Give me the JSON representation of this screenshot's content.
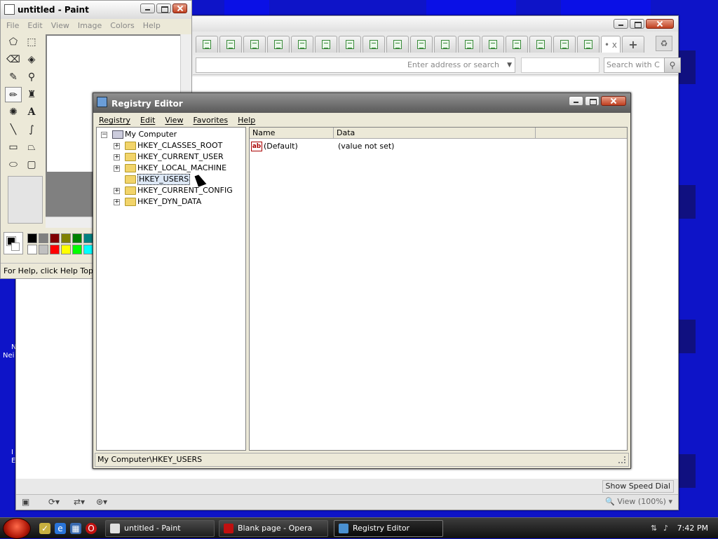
{
  "desktop": {
    "icon_labels": [
      "N",
      "Nei",
      "I",
      "E"
    ]
  },
  "opera": {
    "address_placeholder": "Enter address or search",
    "search_placeholder": "Search with C",
    "speed_dial_button": "Show Speed Dial",
    "zoom_label": "View (100%)",
    "active_tab_label": "• x",
    "new_tab_label": "+"
  },
  "paint": {
    "title": "untitled - Paint",
    "menu": [
      "File",
      "Edit",
      "View",
      "Image",
      "Colors",
      "Help"
    ],
    "status": "For Help, click Help Topics",
    "palette_colors": [
      "#000000",
      "#808080",
      "#800000",
      "#808000",
      "#008000",
      "#008080",
      "#ffffff",
      "#c0c0c0",
      "#ff0000",
      "#ffff00",
      "#00ff00",
      "#00ffff"
    ]
  },
  "regedit": {
    "title": "Registry Editor",
    "menu": [
      "Registry",
      "Edit",
      "View",
      "Favorites",
      "Help"
    ],
    "tree_root": "My Computer",
    "tree_items": [
      {
        "label": "HKEY_CLASSES_ROOT",
        "expandable": true,
        "selected": false
      },
      {
        "label": "HKEY_CURRENT_USER",
        "expandable": true,
        "selected": false
      },
      {
        "label": "HKEY_LOCAL_MACHINE",
        "expandable": true,
        "selected": false
      },
      {
        "label": "HKEY_USERS",
        "expandable": false,
        "selected": true
      },
      {
        "label": "HKEY_CURRENT_CONFIG",
        "expandable": true,
        "selected": false
      },
      {
        "label": "HKEY_DYN_DATA",
        "expandable": true,
        "selected": false
      }
    ],
    "columns": [
      "Name",
      "Data"
    ],
    "values": [
      {
        "icon": "ab",
        "name": "(Default)",
        "data": "(value not set)"
      }
    ],
    "status_path": "My Computer\\HKEY_USERS"
  },
  "taskbar": {
    "tasks": [
      {
        "label": "untitled - Paint",
        "active": false
      },
      {
        "label": "Blank page - Opera",
        "active": false
      },
      {
        "label": "Registry Editor",
        "active": true
      }
    ],
    "clock": "7:42 PM"
  }
}
